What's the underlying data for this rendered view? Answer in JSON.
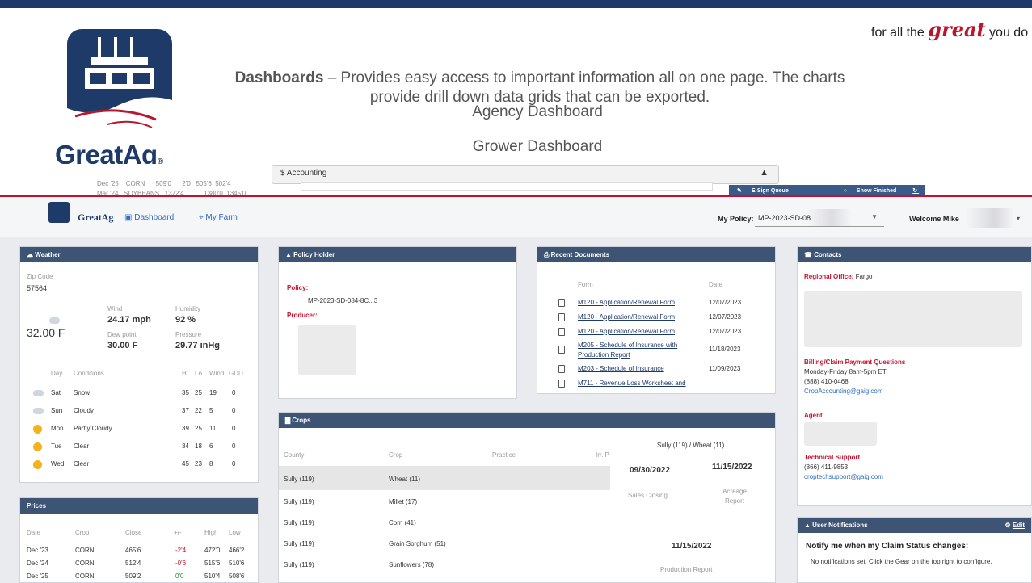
{
  "slide": {
    "brand_name": "GreatAg",
    "brand_reg": "®",
    "tagline_pre": "for all the ",
    "tagline_great": "great",
    "tagline_post": " you do",
    "desc_bold": "Dashboards",
    "desc_text": " – Provides easy access to important information all on one page.  The charts provide drill down data grids that can be exported.",
    "link1": "Agency Dashboard",
    "link2": "Grower Dashboard"
  },
  "background": {
    "accounting_label": "$ Accounting",
    "esign_queue": "E-Sign Queue",
    "show_finished": "Show Finished",
    "refresh": "Refresh",
    "row1": [
      "Dec '25",
      "CORN",
      "509'0",
      "2'0",
      "505'6",
      "502'4"
    ],
    "row2": [
      "Mar '24",
      "SOYBEANS",
      "1372'4",
      "",
      "1380'0",
      "1345'0"
    ]
  },
  "navbar": {
    "brand": "GreatAg",
    "dashboard": "Dashboard",
    "my_farm": "My Farm",
    "policy_label": "My Policy:",
    "policy_value": "MP-2023-SD-08",
    "welcome": "Welcome Mike"
  },
  "weather": {
    "title": "Weather",
    "zip_label": "Zip Code",
    "zip": "57564",
    "temp": "32.00 F",
    "wind_label": "Wind",
    "wind": "24.17 mph",
    "humidity_label": "Humidity",
    "humidity": "92 %",
    "dew_label": "Dew point",
    "dew": "30.00 F",
    "pressure_label": "Pressure",
    "pressure": "29.77 inHg",
    "headers": [
      "Day",
      "Conditions",
      "Hi",
      "Lo",
      "Wind",
      "GDD"
    ],
    "days": [
      {
        "day": "Sat",
        "cond": "Snow",
        "hi": "35",
        "lo": "25",
        "wind": "19",
        "gdd": "0",
        "icon": "snow"
      },
      {
        "day": "Sun",
        "cond": "Cloudy",
        "hi": "37",
        "lo": "22",
        "wind": "5",
        "gdd": "0",
        "icon": "cloud"
      },
      {
        "day": "Mon",
        "cond": "Partly Cloudy",
        "hi": "39",
        "lo": "25",
        "wind": "11",
        "gdd": "0",
        "icon": "sun"
      },
      {
        "day": "Tue",
        "cond": "Clear",
        "hi": "34",
        "lo": "18",
        "wind": "6",
        "gdd": "0",
        "icon": "sun"
      },
      {
        "day": "Wed",
        "cond": "Clear",
        "hi": "45",
        "lo": "23",
        "wind": "8",
        "gdd": "0",
        "icon": "sun"
      }
    ]
  },
  "prices": {
    "title": "Prices",
    "headers": [
      "Date",
      "Crop",
      "Close",
      "+/-",
      "High",
      "Low"
    ],
    "rows": [
      {
        "date": "Dec '23",
        "crop": "CORN",
        "close": "465'6",
        "chg": "-2'4",
        "high": "472'0",
        "low": "466'2",
        "dir": "neg"
      },
      {
        "date": "Dec '24",
        "crop": "CORN",
        "close": "512'4",
        "chg": "-0'6",
        "high": "515'6",
        "low": "510'6",
        "dir": "neg"
      },
      {
        "date": "Dec '25",
        "crop": "CORN",
        "close": "509'2",
        "chg": "0'0",
        "high": "510'4",
        "low": "508'6",
        "dir": "pos"
      }
    ]
  },
  "policy_holder": {
    "title": "Policy Holder",
    "policy_label": "Policy:",
    "policy_value": "MP-2023-SD-084-8C...3",
    "producer_label": "Producer:"
  },
  "recent_docs": {
    "title": "Recent Documents",
    "headers": [
      "Form",
      "Date"
    ],
    "rows": [
      {
        "form": "M120 - Application/Renewal Form",
        "date": "12/07/2023"
      },
      {
        "form": "M120 - Application/Renewal Form",
        "date": "12/07/2023"
      },
      {
        "form": "M120 - Application/Renewal Form",
        "date": "12/07/2023"
      },
      {
        "form": "M205 - Schedule of Insurance with Production Report",
        "date": "11/18/2023"
      },
      {
        "form": "M203 - Schedule of Insurance",
        "date": "11/09/2023"
      },
      {
        "form": "M711 - Revenue Loss Worksheet and",
        "date": ""
      }
    ]
  },
  "contacts": {
    "title": "Contacts",
    "regional_label": "Regional Office:",
    "regional_value": "Fargo",
    "billing_label": "Billing/Claim Payment Questions",
    "billing_hours": "Monday-Friday 8am-5pm ET",
    "billing_phone": "(888) 410-0468",
    "billing_email": "CropAccounting@gaig.com",
    "agent_label": "Agent",
    "tech_label": "Technical Support",
    "tech_phone": "(866) 411-9853",
    "tech_email": "croptechsupport@gaig.com"
  },
  "crops": {
    "title": "Crops",
    "headers": [
      "County",
      "Crop",
      "Practice",
      "Irr. P"
    ],
    "rows": [
      {
        "county": "Sully (119)",
        "crop": "Wheat (11)"
      },
      {
        "county": "Sully (119)",
        "crop": "Millet (17)"
      },
      {
        "county": "Sully (119)",
        "crop": "Corn (41)"
      },
      {
        "county": "Sully (119)",
        "crop": "Grain Sorghum (51)"
      },
      {
        "county": "Sully (119)",
        "crop": "Sunflowers (78)"
      }
    ],
    "detail_title": "Sully (119) / Wheat (11)",
    "date1": "09/30/2022",
    "date1_label": "Sales Closing",
    "date2": "11/15/2022",
    "date2_label": "Acreage Report",
    "date3": "11/15/2022",
    "date3_label": "Production Report"
  },
  "notifications": {
    "title": "User Notifications",
    "edit": "Edit",
    "heading": "Notify me when my Claim Status changes:",
    "text": "No notifications set. Click the Gear on the top right to configure."
  }
}
